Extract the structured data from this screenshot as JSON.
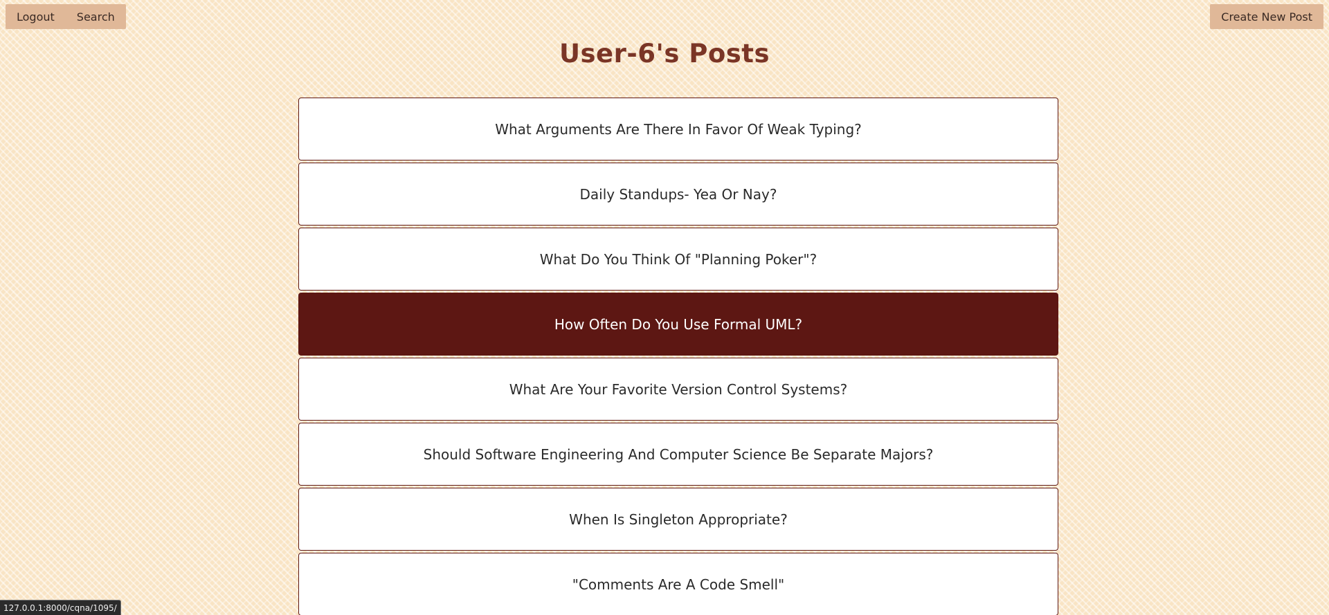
{
  "nav": {
    "logout_label": "Logout",
    "search_label": "Search",
    "create_label": "Create New Post"
  },
  "page": {
    "title": "User-6's Posts"
  },
  "posts": [
    {
      "title": "What Arguments Are There In Favor Of Weak Typing?"
    },
    {
      "title": "Daily Standups- Yea Or Nay?"
    },
    {
      "title": "What Do You Think Of \"Planning Poker\"?"
    },
    {
      "title": "How Often Do You Use Formal UML?",
      "hovered": true
    },
    {
      "title": "What Are Your Favorite Version Control Systems?"
    },
    {
      "title": "Should Software Engineering And Computer Science Be Separate Majors?"
    },
    {
      "title": "When Is Singleton Appropriate?"
    },
    {
      "title": "\"Comments Are A Code Smell\""
    }
  ],
  "status_bar": {
    "url": "127.0.0.1:8000/cqna/1095/"
  },
  "colors": {
    "background": "#f9e4c4",
    "nav_button": "#e0b898",
    "title": "#7a3526",
    "accent": "#5d1713"
  }
}
